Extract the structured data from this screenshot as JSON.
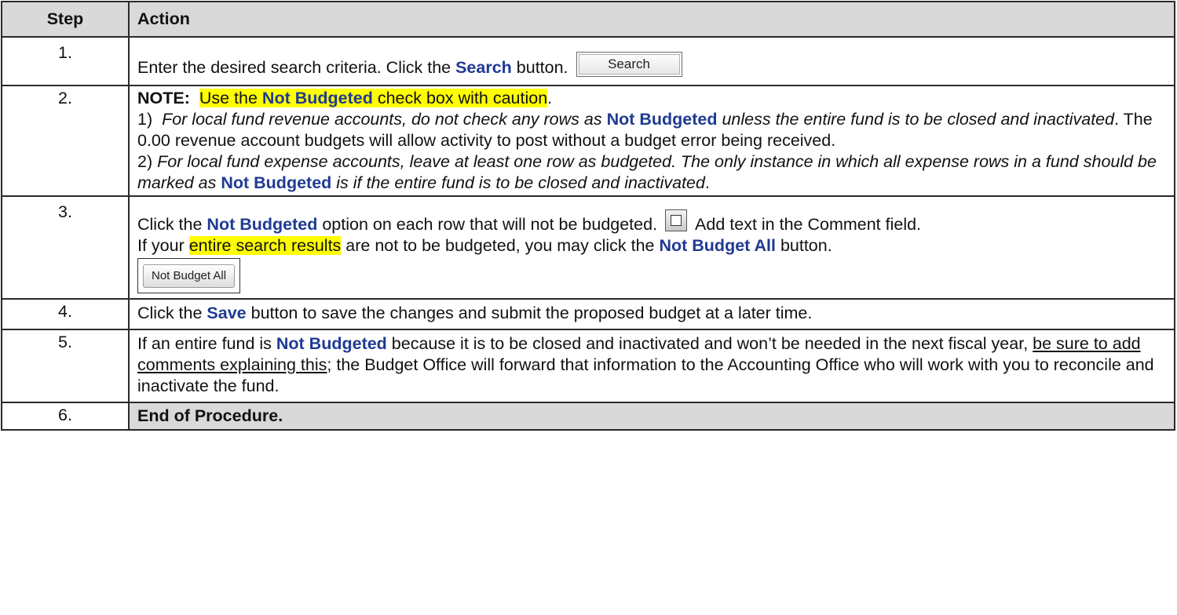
{
  "header": {
    "step": "Step",
    "action": "Action"
  },
  "rows": [
    {
      "step": "1.",
      "text_a": "Enter the desired search criteria. Click the ",
      "bold": "Search",
      "text_b": " button.",
      "button_label": "Search"
    },
    {
      "step": "2.",
      "note_label": "NOTE:",
      "note_hl_a": "Use the ",
      "note_hl_bold": "Not Budgeted",
      "note_hl_b": " check box with caution",
      "note_end": ".",
      "p1_num": "1)",
      "p1_it_a": "For local fund revenue accounts, do not check any rows as ",
      "p1_bold": "Not Budgeted",
      "p1_it_b": " unless the entire fund is to be closed and inactivated",
      "p1_rest": ".  The 0.00 revenue account budgets will allow activity to post without a budget error being received.",
      "p2_num": "2)",
      "p2_it_a": "For local fund expense accounts, leave at least one row as budgeted.  The only instance in which all expense rows in a fund should be marked as ",
      "p2_bold": "Not Budgeted",
      "p2_it_b": " is if the entire fund is to be closed and inactivated",
      "p2_end": "."
    },
    {
      "step": "3.",
      "l1_a": "Click the ",
      "l1_bold": "Not Budgeted",
      "l1_b": " option on each row that will not be budgeted.",
      "l1_c": "Add text in the Comment field.",
      "l2_a": "If your ",
      "l2_hl": "entire search results",
      "l2_b": " are not to be budgeted, you may click the ",
      "l2_bold": "Not Budget All",
      "l2_c": " button.",
      "button_label": "Not Budget All"
    },
    {
      "step": "4.",
      "text_a": "Click the ",
      "bold": "Save",
      "text_b": " button to save the changes and submit the proposed budget at a later time."
    },
    {
      "step": "5.",
      "text_a": "If an entire fund is ",
      "bold": "Not Budgeted",
      "text_b": "  because it is to be closed and inactivated and won’t be needed in the next fiscal year, ",
      "underline": "be sure to add comments explaining this",
      "text_c": "; the Budget Office will forward that information to the Accounting Office who will work with you to reconcile and inactivate the fund."
    },
    {
      "step": "6.",
      "text": "End of Procedure."
    }
  ]
}
